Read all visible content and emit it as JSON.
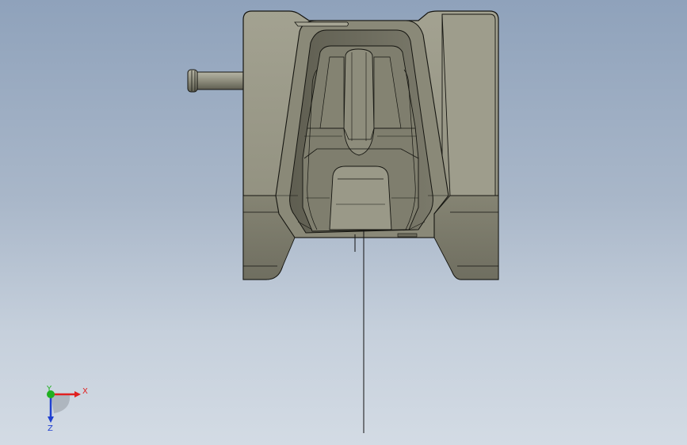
{
  "viewport": {
    "model": "mold-part",
    "view_orientation": "front"
  },
  "triad": {
    "x_label": "X",
    "y_label": "Y",
    "z_label": "Z",
    "x_color": "#e02020",
    "y_color": "#20b020",
    "z_color": "#2040d0"
  },
  "colors": {
    "part_face": "#8f8e7d",
    "part_face_dark": "#6e6d5e",
    "part_face_light": "#a6a594",
    "edge": "#151510",
    "background_top": "#8fa2bb",
    "background_bottom": "#d3dbe4"
  }
}
